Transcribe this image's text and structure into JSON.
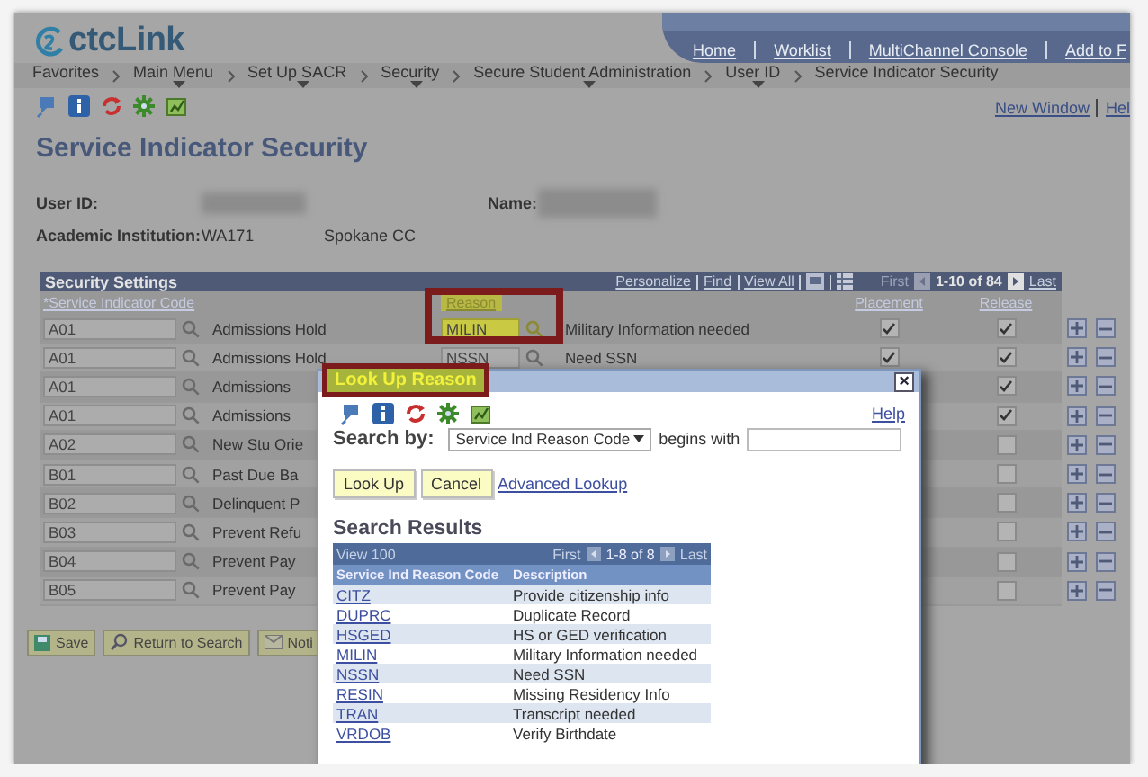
{
  "header": {
    "logo": "ctcLink",
    "links": [
      "Home",
      "Worklist",
      "MultiChannel Console",
      "Add to F"
    ]
  },
  "breadcrumb": [
    {
      "label": "Favorites",
      "menu": false
    },
    {
      "label": "Main Menu",
      "menu": true
    },
    {
      "label": "Set Up SACR",
      "menu": true
    },
    {
      "label": "Security",
      "menu": true
    },
    {
      "label": "Secure Student Administration",
      "menu": true
    },
    {
      "label": "User ID",
      "menu": true
    },
    {
      "label": "Service Indicator Security",
      "menu": false
    }
  ],
  "page_links": [
    "New Window",
    "Hel"
  ],
  "page_title": "Service Indicator Security",
  "fields": {
    "user_id_label": "User ID:",
    "name_label": "Name:",
    "institution_label": "Academic Institution:",
    "institution_code": "WA171",
    "institution_name": "Spokane CC"
  },
  "grid": {
    "title": "Security Settings",
    "nav_links": [
      "Personalize",
      "Find",
      "View All"
    ],
    "first": "First",
    "count": "1-10 of 84",
    "last": "Last",
    "columns": [
      "*Service Indicator Code",
      "Reason",
      "Placement",
      "Release"
    ],
    "reason_highlighted": true,
    "rows": [
      {
        "code": "A01",
        "description": "Admissions Hold",
        "reason": "MILIN",
        "reason_description": "Military Information needed",
        "placement": true,
        "release": true
      },
      {
        "code": "A01",
        "description": "Admissions Hold",
        "reason": "NSSN",
        "reason_description": "Need SSN",
        "placement": true,
        "release": true
      },
      {
        "code": "A01",
        "description": "Admissions",
        "release": true
      },
      {
        "code": "A01",
        "description": "Admissions",
        "release": true
      },
      {
        "code": "A02",
        "description": "New Stu Orie",
        "release": false
      },
      {
        "code": "B01",
        "description": "Past Due Ba",
        "release": false
      },
      {
        "code": "B02",
        "description": "Delinquent P",
        "release": false
      },
      {
        "code": "B03",
        "description": "Prevent Refu",
        "release": false
      },
      {
        "code": "B04",
        "description": "Prevent Pay",
        "release": false
      },
      {
        "code": "B05",
        "description": "Prevent Pay",
        "release": false
      }
    ]
  },
  "footer_buttons": [
    {
      "label": "Save",
      "kind": "save"
    },
    {
      "label": "Return to Search",
      "kind": "search"
    },
    {
      "label": "Noti",
      "kind": "notify"
    }
  ],
  "modal": {
    "title": "Look Up Reason",
    "title_highlighted": true,
    "close": "×",
    "help": "Help",
    "search_by_label": "Search by:",
    "search_field": "Service Ind Reason Code",
    "operator": "begins with",
    "buttons": [
      "Look Up",
      "Cancel"
    ],
    "advanced_link": "Advanced Lookup",
    "results_title": "Search Results",
    "view_all": "View 100",
    "first": "First",
    "count": "1-8 of 8",
    "last": "Last",
    "columns": [
      "Service Ind Reason Code",
      "Description"
    ],
    "results": [
      {
        "code": "CITZ",
        "description": "Provide citizenship info"
      },
      {
        "code": "DUPRC",
        "description": "Duplicate Record"
      },
      {
        "code": "HSGED",
        "description": "HS or GED verification"
      },
      {
        "code": "MILIN",
        "description": "Military Information needed"
      },
      {
        "code": "NSSN",
        "description": "Need SSN"
      },
      {
        "code": "RESIN",
        "description": "Missing Residency Info"
      },
      {
        "code": "TRAN",
        "description": "Transcript needed"
      },
      {
        "code": "VRDOB",
        "description": "Verify Birthdate"
      }
    ]
  }
}
